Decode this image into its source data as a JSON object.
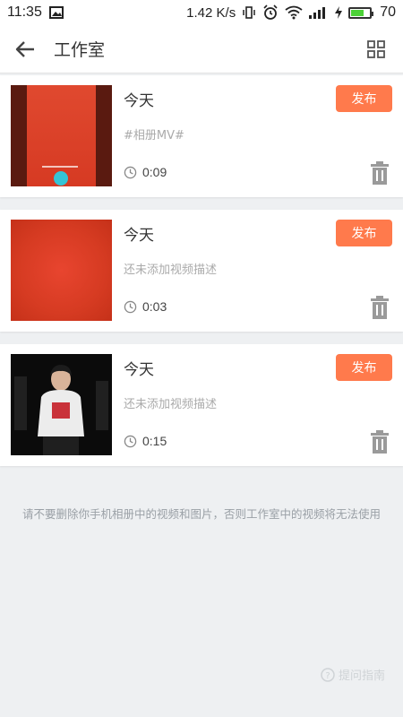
{
  "status_bar": {
    "time": "11:35",
    "speed": "1.42 K/s",
    "battery": "70",
    "battery_level": 0.7
  },
  "header": {
    "title": "工作室",
    "back_icon": "arrow-left-icon",
    "grid_icon": "grid-icon"
  },
  "items": [
    {
      "day": "今天",
      "description": "#相册MV#",
      "duration": "0:09",
      "publish_label": "发布"
    },
    {
      "day": "今天",
      "description": "还未添加视频描述",
      "duration": "0:03",
      "publish_label": "发布"
    },
    {
      "day": "今天",
      "description": "还未添加视频描述",
      "duration": "0:15",
      "publish_label": "发布"
    }
  ],
  "footer_note": "请不要删除你手机相册中的视频和图片，否则工作室中的视频将无法使用",
  "watermark": "提问指南",
  "colors": {
    "accent": "#ff7a4c",
    "background": "#eef0f2"
  }
}
